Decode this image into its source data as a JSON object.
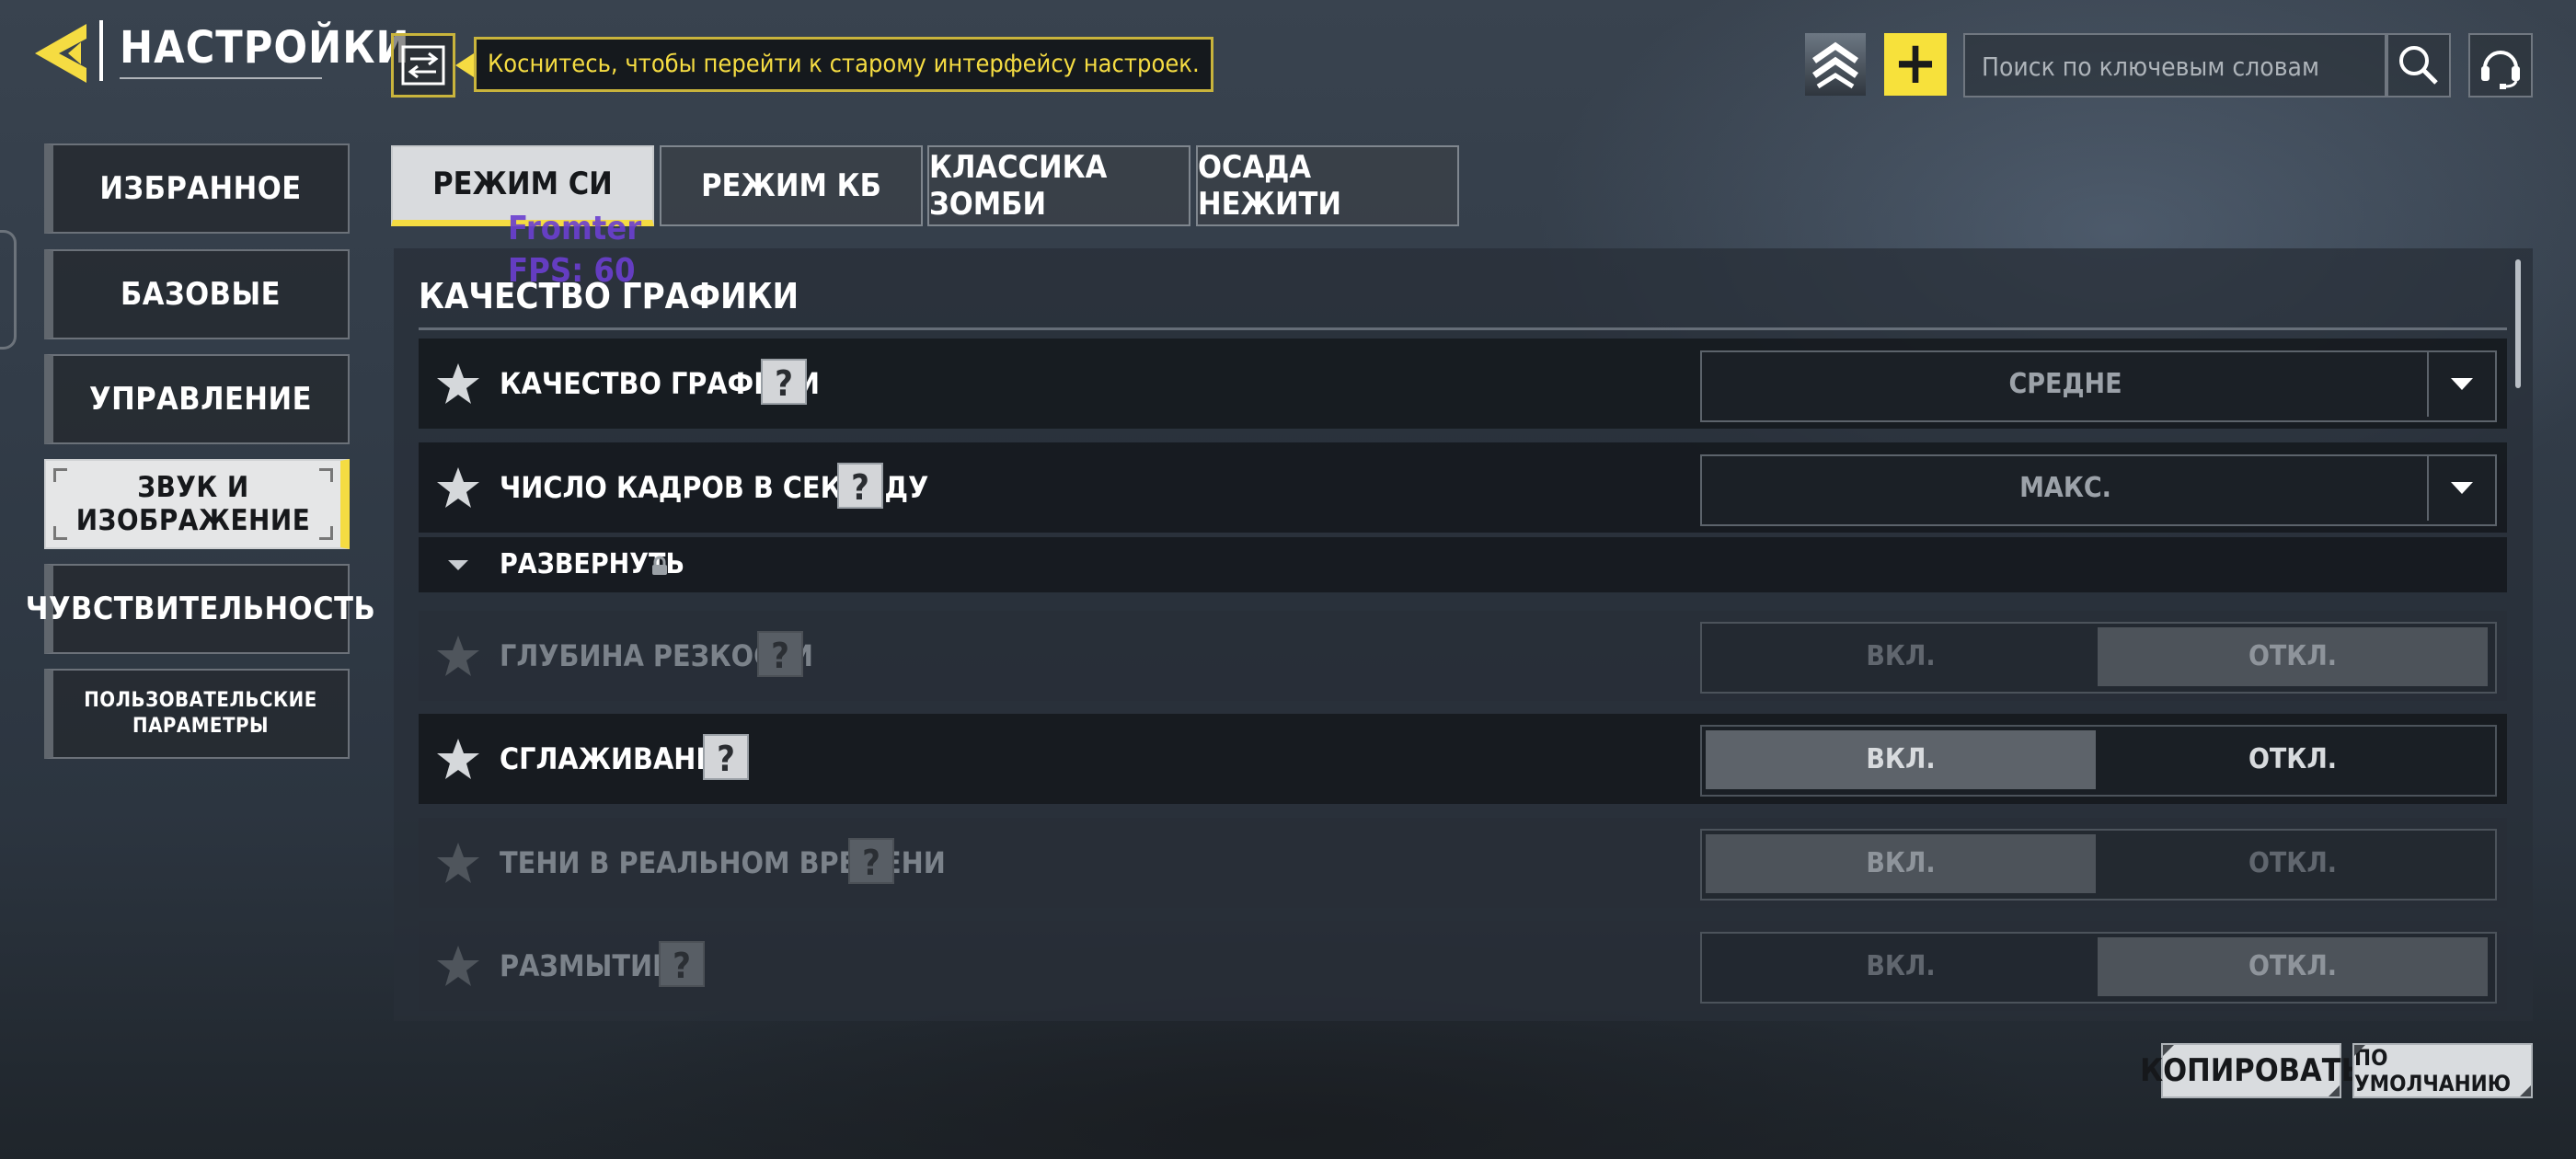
{
  "header": {
    "title": "НАСТРОЙКИ",
    "tooltip": "Коснитесь, чтобы перейти к старому интерфейсу настроек.",
    "search_placeholder": "Поиск по ключевым словам"
  },
  "colors": {
    "accent": "#f5dc42",
    "active_bg": "#e5e6e7"
  },
  "sidebar": {
    "items": [
      {
        "label": "ИЗБРАННОЕ"
      },
      {
        "label": "БАЗОВЫЕ"
      },
      {
        "label": "УПРАВЛЕНИЕ"
      },
      {
        "label": "ЗВУК И ИЗОБРАЖЕНИЕ",
        "active": true
      },
      {
        "label": "ЧУВСТВИТЕЛЬНОСТЬ"
      },
      {
        "label_line1": "ПОЛЬЗОВАТЕЛЬСКИЕ",
        "label_line2": "ПАРАМЕТРЫ"
      }
    ]
  },
  "tabs": [
    {
      "label": "РЕЖИМ СИ",
      "active": true
    },
    {
      "label": "РЕЖИМ КБ"
    },
    {
      "label": "КЛАССИКА ЗОМБИ"
    },
    {
      "label": "ОСАДА НЕЖИТИ"
    }
  ],
  "overlay": {
    "line1": "Fromter",
    "line2": "FPS: 60"
  },
  "section": {
    "title": "КАЧЕСТВО ГРАФИКИ"
  },
  "settings": [
    {
      "label": "КАЧЕСТВО ГРАФИКИ",
      "value": "СРЕДНЕ"
    },
    {
      "label": "ЧИСЛО КАДРОВ В СЕКУНДУ",
      "value": "МАКС."
    },
    {
      "label": "ГЛУБИНА РЕЗКОСТИ",
      "on": "ВКЛ.",
      "off": "ОТКЛ.",
      "selected": "off"
    },
    {
      "label": "СГЛАЖИВАНИЕ",
      "on": "ВКЛ.",
      "off": "ОТКЛ.",
      "selected": "on"
    },
    {
      "label": "ТЕНИ В РЕАЛЬНОМ ВРЕМЕНИ",
      "on": "ВКЛ.",
      "off": "ОТКЛ.",
      "selected": "on"
    },
    {
      "label": "РАЗМЫТИЕ",
      "on": "ВКЛ.",
      "off": "ОТКЛ.",
      "selected": "off"
    }
  ],
  "expand": {
    "label": "РАЗВЕРНУТЬ"
  },
  "help_glyph": "?",
  "buttons": {
    "copy": "КОПИРОВАТЬ",
    "default": "ПО УМОЛЧАНИЮ",
    "add": "+"
  },
  "icons": [
    "back-arrow-icon",
    "switch-icon",
    "rank-chevron-icon",
    "search-icon",
    "headset-icon",
    "star-icon",
    "lock-icon",
    "chevron-down-icon"
  ]
}
